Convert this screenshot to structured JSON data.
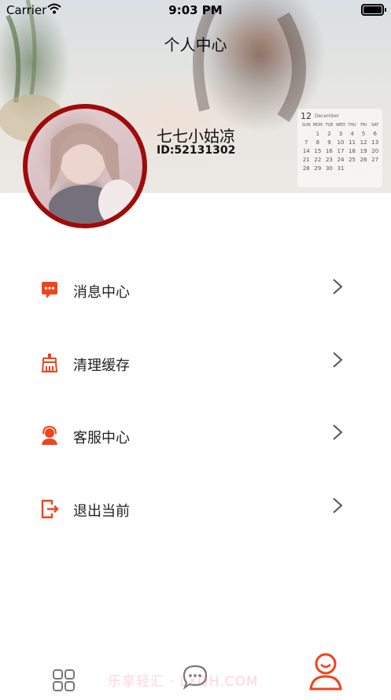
{
  "status_bar": {
    "carrier": "Carrier",
    "time": "9:03 PM"
  },
  "header": {
    "title": "个人中心",
    "nickname": "七七小姑凉",
    "user_id": "ID:52131302",
    "calendar": {
      "month": "12",
      "month_name": "December",
      "weekdays": [
        "SUN",
        "MON",
        "TUE",
        "WED",
        "THU",
        "FRI",
        "SAT"
      ],
      "days": [
        "",
        "1",
        "2",
        "3",
        "4",
        "5",
        "6",
        "7",
        "8",
        "9",
        "10",
        "11",
        "12",
        "13",
        "14",
        "15",
        "16",
        "17",
        "18",
        "19",
        "20",
        "21",
        "22",
        "23",
        "24",
        "25",
        "26",
        "27",
        "28",
        "29",
        "30",
        "31",
        "",
        "",
        "",
        ""
      ]
    }
  },
  "menu": [
    {
      "label": "消息中心",
      "icon": "message-icon"
    },
    {
      "label": "清理缓存",
      "icon": "broom-icon"
    },
    {
      "label": "客服中心",
      "icon": "customer-service-icon"
    },
    {
      "label": "退出当前",
      "icon": "logout-icon"
    }
  ],
  "tabbar": {
    "items": [
      {
        "icon": "grid-icon",
        "active": false
      },
      {
        "icon": "chat-icon",
        "active": false
      },
      {
        "icon": "profile-icon",
        "active": true
      }
    ],
    "watermark": "乐享轻汇 · LXQH.COM"
  },
  "colors": {
    "accent": "#f0441b",
    "avatar_border": "#a00a0a",
    "inactive_icon": "#777777"
  }
}
